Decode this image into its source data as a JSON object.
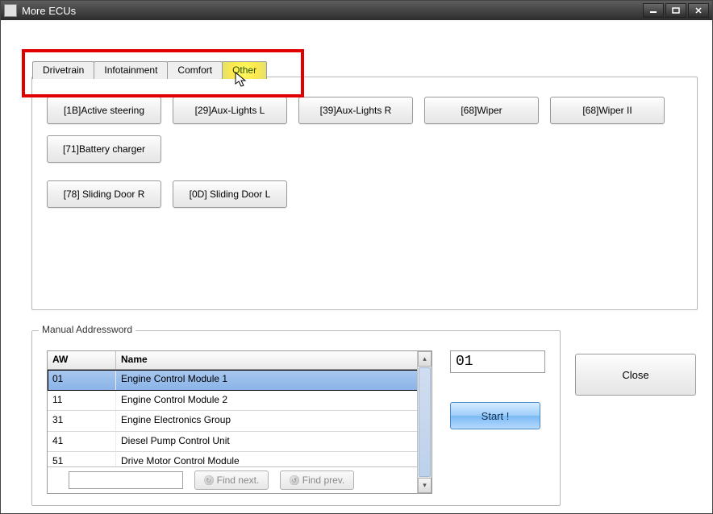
{
  "window": {
    "title": "More ECUs"
  },
  "tabs": {
    "items": [
      {
        "label": "Drivetrain"
      },
      {
        "label": "Infotainment"
      },
      {
        "label": "Comfort"
      },
      {
        "label": "Other"
      }
    ],
    "active_index": 3
  },
  "ecu_buttons": {
    "row1": [
      "[1B]Active steering",
      "[29]Aux-Lights  L",
      "[39]Aux-Lights  R",
      "[68]Wiper",
      "[68]Wiper II",
      "[71]Battery charger"
    ],
    "row2": [
      "[78] Sliding Door R",
      "[0D] Sliding Door L"
    ]
  },
  "manual": {
    "legend": "Manual Addressword",
    "columns": {
      "aw": "AW",
      "name": "Name"
    },
    "rows": [
      {
        "aw": "01",
        "name": "Engine Control Module 1",
        "selected": true
      },
      {
        "aw": "11",
        "name": "Engine Control Module 2",
        "selected": false
      },
      {
        "aw": "31",
        "name": "Engine Electronics Group",
        "selected": false
      },
      {
        "aw": "41",
        "name": "Diesel Pump Control Unit",
        "selected": false
      },
      {
        "aw": "51",
        "name": "Drive Motor Control Module",
        "selected": false
      }
    ],
    "find_next": "Find next.",
    "find_prev": "Find prev.",
    "aw_input": "01",
    "start": "Start !"
  },
  "close": "Close"
}
